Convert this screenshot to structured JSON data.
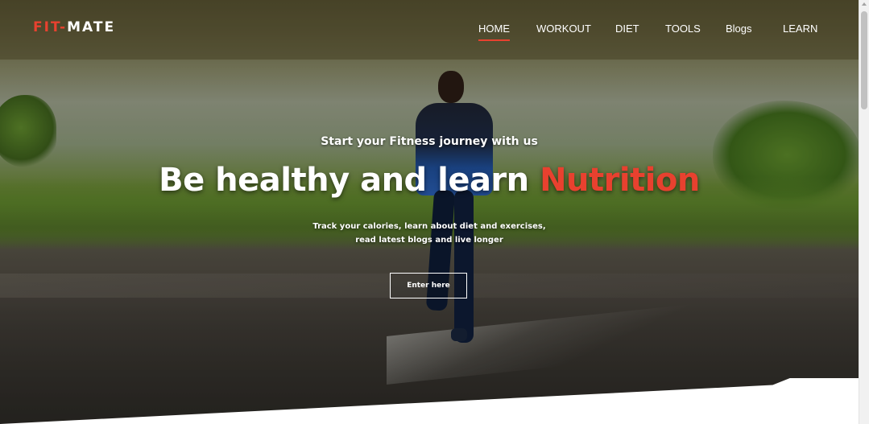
{
  "navbar": {
    "logo": {
      "part1": "FIT-",
      "part2": "MATE"
    },
    "items": [
      {
        "label": "HOME",
        "active": true
      },
      {
        "label": "WORKOUT",
        "active": false
      },
      {
        "label": "DIET",
        "active": false
      },
      {
        "label": "TOOLS",
        "active": false
      },
      {
        "label": "Blogs",
        "active": false
      },
      {
        "label": "LEARN",
        "active": false
      }
    ]
  },
  "hero": {
    "tagline": "Start your Fitness journey with us",
    "headline_main": "Be healthy and learn ",
    "headline_highlight": "Nutrition",
    "description_line1": "Track your calories, learn about diet and exercises,",
    "description_line2": "read latest blogs and live longer",
    "cta_label": "Enter here"
  },
  "colors": {
    "accent": "#e8412f",
    "text": "#ffffff"
  }
}
